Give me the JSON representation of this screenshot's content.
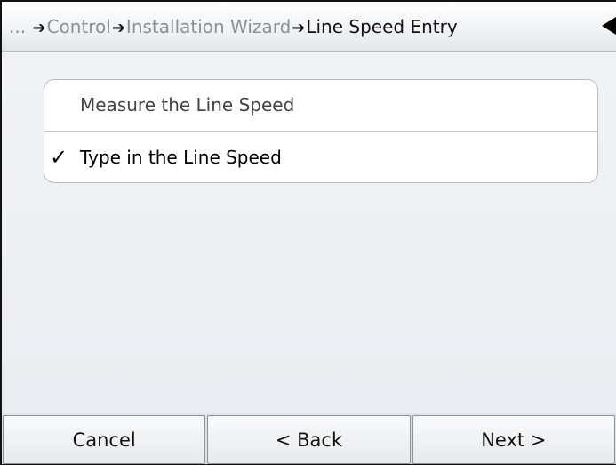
{
  "header": {
    "breadcrumb": [
      {
        "label": "...",
        "current": false
      },
      {
        "label": "Control",
        "current": false
      },
      {
        "label": "Installation Wizard",
        "current": false
      },
      {
        "label": "Line Speed Entry",
        "current": true
      }
    ],
    "separator": "➔",
    "back_icon": "back-triangle-icon"
  },
  "options": [
    {
      "label": "Measure the Line Speed",
      "selected": false
    },
    {
      "label": "Type in the Line Speed",
      "selected": true
    }
  ],
  "check_glyph": "✓",
  "footer": {
    "cancel_label": "Cancel",
    "back_label": "< Back",
    "next_label": "Next >"
  }
}
